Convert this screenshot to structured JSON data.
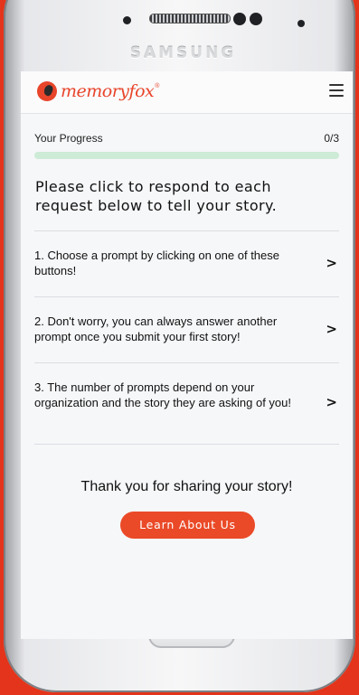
{
  "device": {
    "brand_text": "SAMSUNG"
  },
  "header": {
    "logo_text": "memoryfox",
    "logo_tm": "®",
    "menu_icon": "hamburger-icon"
  },
  "progress": {
    "label": "Your Progress",
    "count": "0/3",
    "completed": 0,
    "total": 3
  },
  "heading": "Please click to respond to each request below to tell your story.",
  "prompts": [
    {
      "text": "1. Choose a prompt by clicking on one of these buttons!"
    },
    {
      "text": "2. Don't worry, you can always answer another prompt once you submit your first story!"
    },
    {
      "text": "3. The number of prompts depend on your organization and the story they are asking of you!"
    }
  ],
  "chevron_glyph": ">",
  "footer": {
    "thanks": "Thank you for sharing your story!",
    "cta_label": "Learn About Us"
  },
  "colors": {
    "accent": "#ea4a28",
    "background": "#e4341b",
    "progress_track": "#cdebd6",
    "progress_fill": "#43b86a"
  }
}
